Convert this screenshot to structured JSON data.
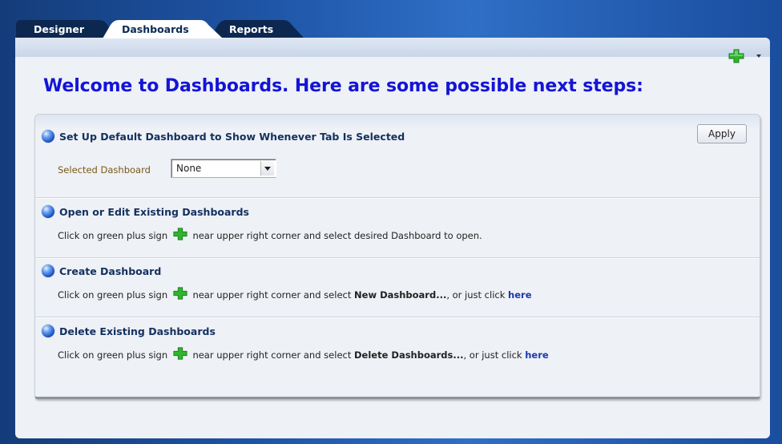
{
  "tabs": [
    {
      "label": "Designer"
    },
    {
      "label": "Dashboards"
    },
    {
      "label": "Reports"
    }
  ],
  "welcome_title": "Welcome to Dashboards.  Here are some possible next steps:",
  "sections": {
    "setup": {
      "title": "Set Up Default Dashboard to Show Whenever Tab Is Selected",
      "apply_label": "Apply",
      "selected_label": "Selected Dashboard",
      "selected_value": "None"
    },
    "open": {
      "title": "Open or Edit Existing Dashboards",
      "text_before": "Click on green plus sign",
      "text_after": "near upper right corner and select desired Dashboard to open."
    },
    "create": {
      "title": "Create Dashboard",
      "text_before": "Click on green plus sign",
      "text_mid": "near upper right corner and select",
      "bold": "New Dashboard...",
      "text_after": ", or just click",
      "link": "here"
    },
    "delete": {
      "title": "Delete Existing Dashboards",
      "text_before": "Click on green plus sign",
      "text_mid": "near upper right corner and select",
      "bold": "Delete Dashboards...",
      "text_after": ", or just click",
      "link": "here"
    }
  },
  "icons": {
    "add": "plus-icon",
    "menu": "chevron-down-icon",
    "bullet": "blue-sphere-icon"
  },
  "colors": {
    "title_blue": "#1414d6",
    "plus_green": "#2fb52f",
    "link_blue": "#1a3aa8"
  }
}
